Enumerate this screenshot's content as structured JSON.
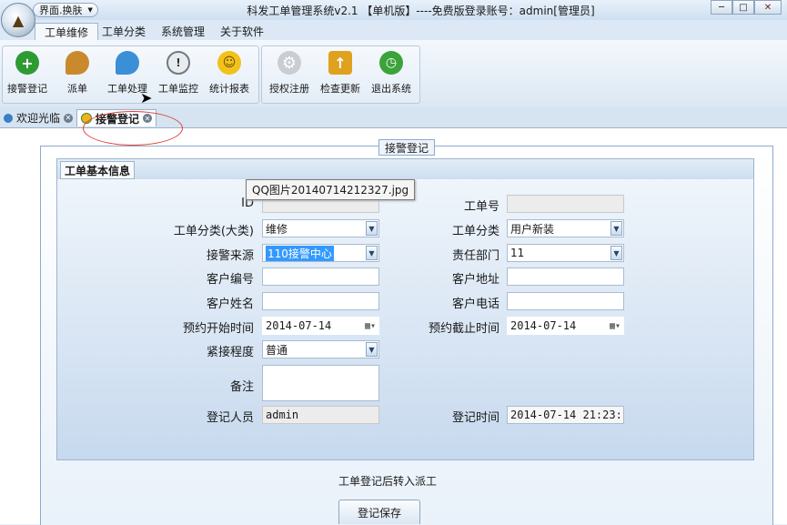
{
  "window": {
    "title": "科发工单管理系统v2.1 【单机版】----免费版登录账号：admin[管理员]",
    "skin_label": "界面.换肤",
    "min": "─",
    "max": "□"
  },
  "menu_tabs": [
    "工单维修",
    "工单分类",
    "系统管理",
    "关于软件"
  ],
  "ribbon": {
    "group1": [
      {
        "label": "接警登记",
        "icon": "add-icon",
        "color": "#2e9b32"
      },
      {
        "label": "派单",
        "icon": "chat-icon",
        "color": "#c98a2e"
      },
      {
        "label": "工单处理",
        "icon": "message-icon",
        "color": "#3b8fd6"
      },
      {
        "label": "工单监控",
        "icon": "clock-alert-icon",
        "color": "#707a84"
      },
      {
        "label": "统计报表",
        "icon": "smiley-icon",
        "color": "#f2c21b"
      }
    ],
    "group2": [
      {
        "label": "授权注册",
        "icon": "gear-icon",
        "color": "#9aa3ad"
      },
      {
        "label": "检查更新",
        "icon": "update-icon",
        "color": "#e0a11f"
      },
      {
        "label": "退出系统",
        "icon": "exit-clock-icon",
        "color": "#3ba33a"
      }
    ]
  },
  "doc_tabs": [
    {
      "label": "欢迎光临",
      "icon_color": "#3b7fc4"
    },
    {
      "label": "接警登记",
      "icon_color": "#f2b11b"
    }
  ],
  "form": {
    "legend": "接警登记",
    "section_title": "工单基本信息",
    "tooltip": "QQ图片20140714212327.jpg",
    "fields": {
      "id": {
        "label": "ID",
        "value": ""
      },
      "ticket_no": {
        "label": "工单号",
        "value": ""
      },
      "category": {
        "label": "工单分类(大类)",
        "value": "维修"
      },
      "subcategory": {
        "label": "工单分类",
        "value": "用户新装"
      },
      "source": {
        "label": "接警来源",
        "value": "110接警中心"
      },
      "department": {
        "label": "责任部门",
        "value": "11"
      },
      "customer_no": {
        "label": "客户编号",
        "value": ""
      },
      "customer_addr": {
        "label": "客户地址",
        "value": ""
      },
      "customer_name": {
        "label": "客户姓名",
        "value": ""
      },
      "customer_phone": {
        "label": "客户电话",
        "value": ""
      },
      "start_time": {
        "label": "预约开始时间",
        "value": "2014-07-14"
      },
      "end_time": {
        "label": "预约截止时间",
        "value": "2014-07-14"
      },
      "urgency": {
        "label": "紧接程度",
        "value": "普通"
      },
      "remark": {
        "label": "备注",
        "value": ""
      },
      "registrar": {
        "label": "登记人员",
        "value": "admin"
      },
      "reg_time": {
        "label": "登记时间",
        "value": "2014-07-14 21:23:."
      }
    },
    "note": "工单登记后转入派工",
    "save_label": "登记保存"
  }
}
